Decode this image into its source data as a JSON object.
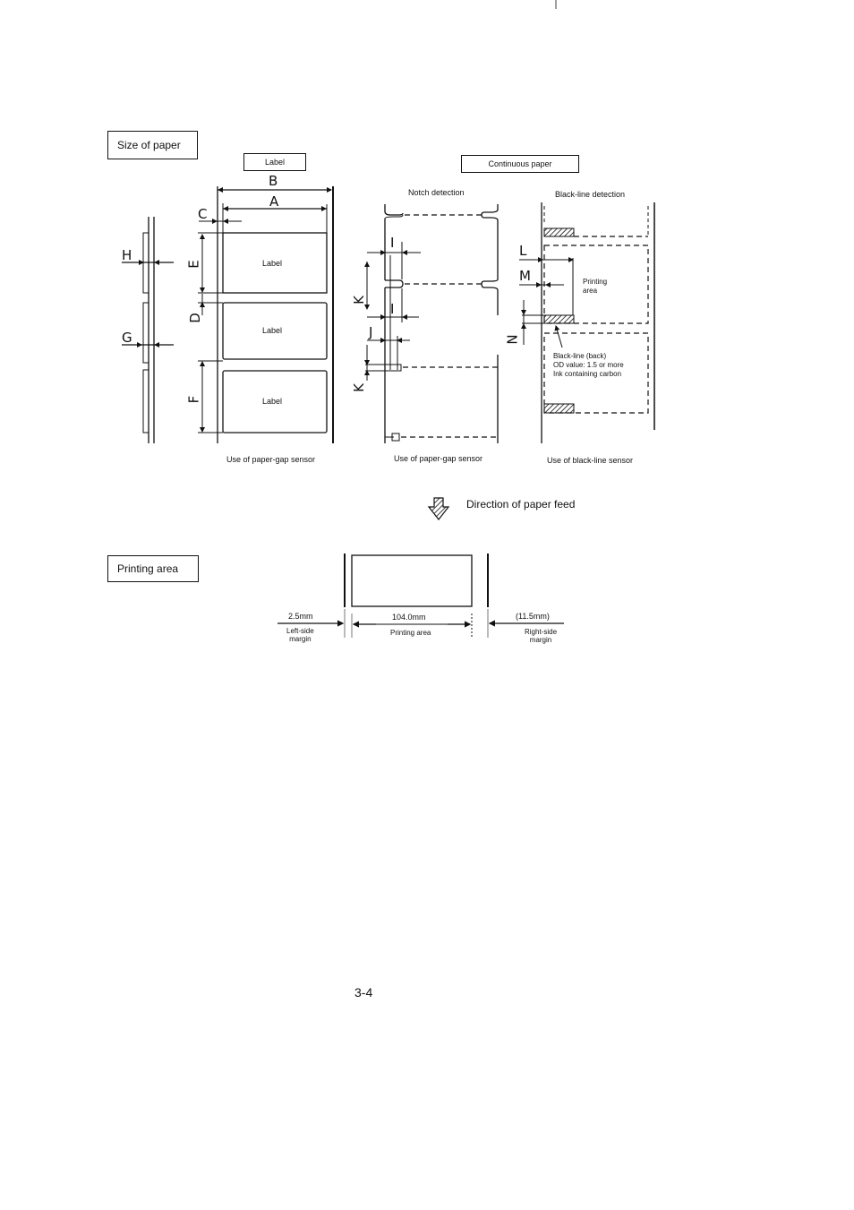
{
  "section_size": {
    "heading": "Size of paper",
    "label_box": "Label",
    "continuous_box": "Continuous paper",
    "labels": [
      "Label",
      "Label",
      "Label"
    ],
    "dims": {
      "A": "A",
      "B": "B",
      "C": "C",
      "D": "D",
      "E": "E",
      "F": "F",
      "G": "G",
      "H": "H",
      "I": "I",
      "J": "J",
      "K": "K",
      "L": "L",
      "M": "M",
      "N": "N"
    },
    "notch_detection": "Notch detection",
    "black_line_detection": "Black-line detection",
    "printing_area": "Printing\narea",
    "black_line_note": [
      "Black-line (back)",
      "OD value: 1.5 or more",
      "Ink containing carbon"
    ],
    "captions": {
      "paper_gap_label": "Use of paper-gap sensor",
      "paper_gap_continuous": "Use of paper-gap sensor",
      "black_line": "Use of black-line sensor"
    },
    "feed_direction": "Direction of paper feed"
  },
  "section_print": {
    "heading": "Printing area",
    "left_margin_value": "2.5mm",
    "left_margin_label": [
      "Left-side",
      "margin"
    ],
    "print_width_value": "104.0mm",
    "print_width_label": "Printing area",
    "right_margin_value": "(11.5mm)",
    "right_margin_label": [
      "Right-side",
      "margin"
    ]
  },
  "page_number": "3-4"
}
